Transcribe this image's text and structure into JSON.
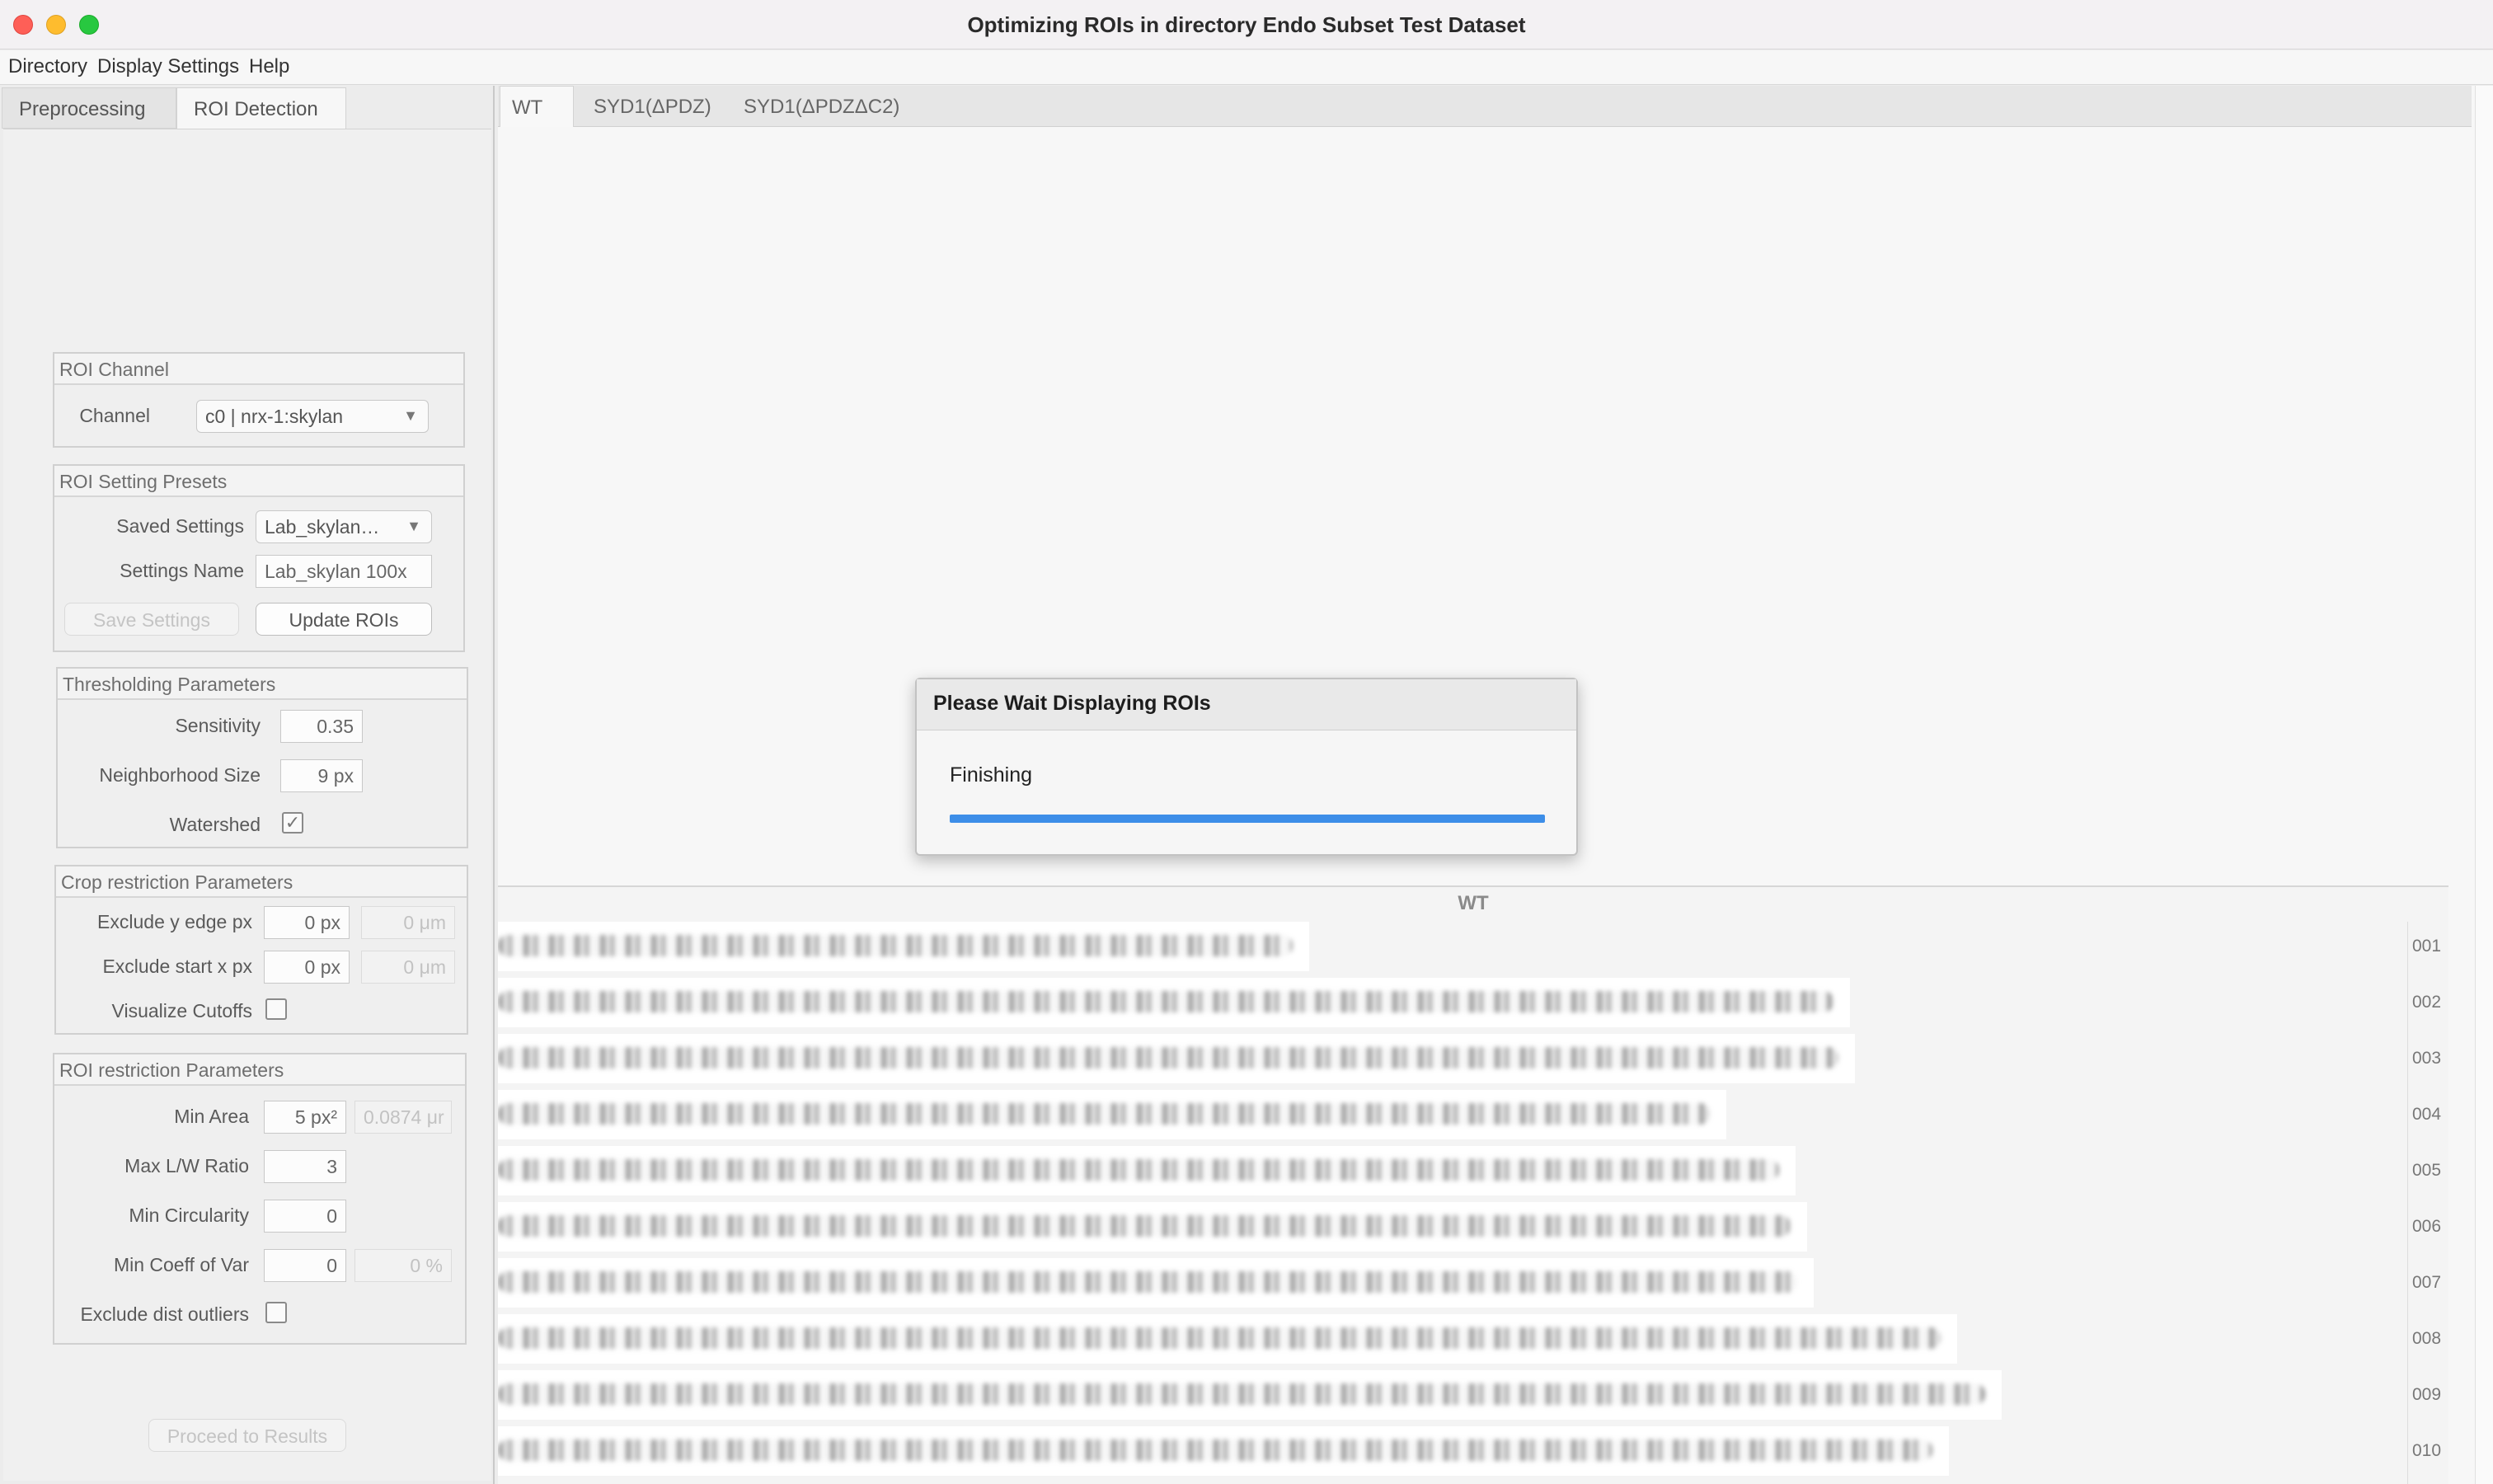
{
  "window": {
    "title": "Optimizing ROIs in directory Endo Subset Test Dataset"
  },
  "menu": [
    "Directory",
    "Display Settings",
    "Help"
  ],
  "left_tabs": [
    {
      "label": "Preprocessing",
      "selected": false
    },
    {
      "label": "ROI Detection",
      "selected": true
    }
  ],
  "roi_channel": {
    "title": "ROI Channel",
    "channel_label": "Channel",
    "channel_value": "c0 | nrx-1:skylan"
  },
  "presets": {
    "title": "ROI Setting Presets",
    "saved_label": "Saved Settings",
    "saved_value": "Lab_skylan…",
    "name_label": "Settings Name",
    "name_value": "Lab_skylan 100x",
    "save_button": "Save Settings",
    "update_button": "Update ROIs"
  },
  "thresholding": {
    "title": "Thresholding Parameters",
    "sensitivity_label": "Sensitivity",
    "sensitivity_value": "0.35",
    "neighborhood_label": "Neighborhood Size",
    "neighborhood_value": "9 px",
    "watershed_label": "Watershed",
    "watershed_checked": true
  },
  "crop": {
    "title": "Crop restriction Parameters",
    "y_edge_label": "Exclude y edge px",
    "y_edge_px": "0 px",
    "y_edge_um": "0 μm",
    "start_x_label": "Exclude start x px",
    "start_x_px": "0 px",
    "start_x_um": "0 μm",
    "visualize_label": "Visualize Cutoffs",
    "visualize_checked": false
  },
  "roi_restrict": {
    "title": "ROI restriction Parameters",
    "min_area_label": "Min Area",
    "min_area_value": "5 px²",
    "min_area_um": "0.0874 μr",
    "max_lw_label": "Max L/W Ratio",
    "max_lw_value": "3",
    "min_circ_label": "Min Circularity",
    "min_circ_value": "0",
    "min_coeff_label": "Min Coeff of Var",
    "min_coeff_value": "0",
    "min_coeff_pct": "0 %",
    "exclude_label": "Exclude dist outliers",
    "exclude_checked": false
  },
  "proceed_button": "Proceed to Results",
  "right_tabs": [
    {
      "label": "WT",
      "selected": true
    },
    {
      "label": "SYD1(ΔPDZ)",
      "selected": false
    },
    {
      "label": "SYD1(ΔPDZΔC2)",
      "selected": false
    }
  ],
  "image_panel": {
    "title": "WT",
    "row_labels": [
      "001",
      "002",
      "003",
      "004",
      "005",
      "006",
      "007",
      "008",
      "009",
      "010"
    ]
  },
  "dialog": {
    "title": "Please Wait Displaying ROIs",
    "status": "Finishing",
    "progress": 1.0,
    "accent_color": "#3d8ee8"
  }
}
